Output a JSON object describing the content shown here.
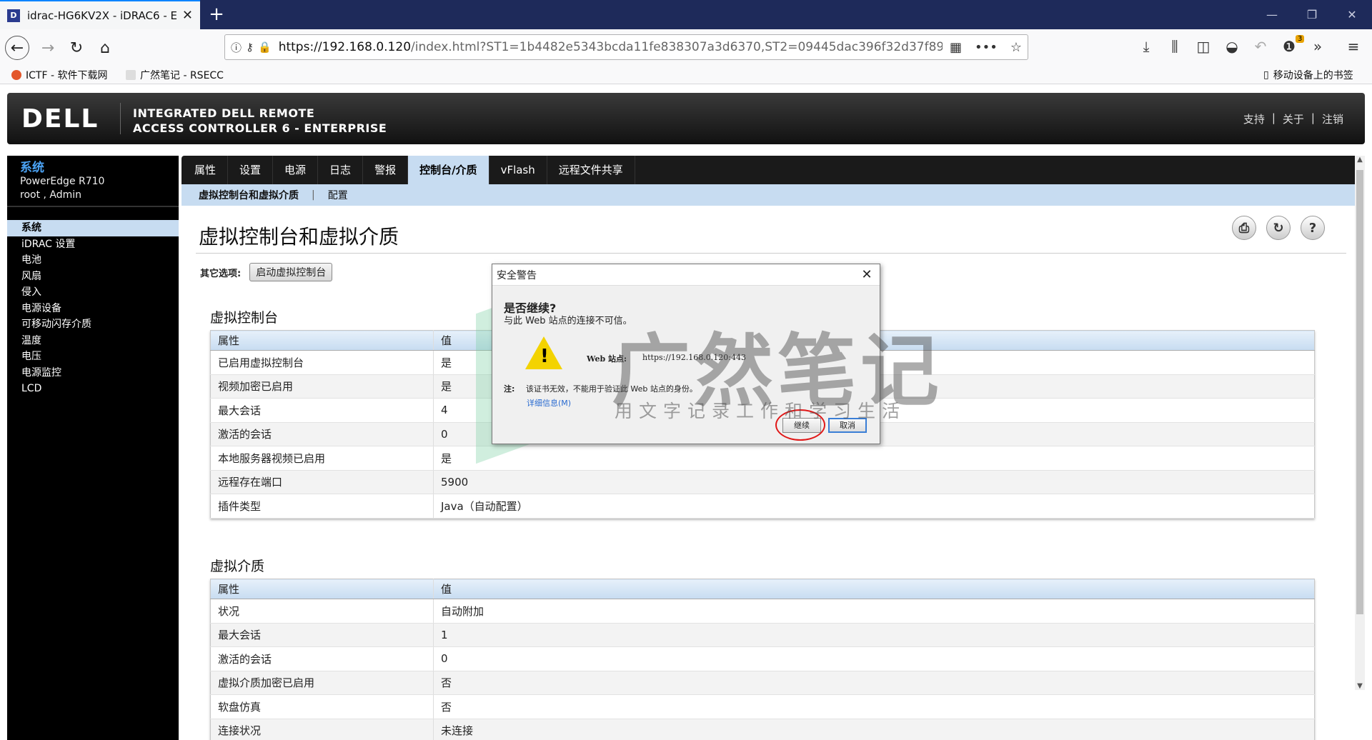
{
  "browser": {
    "tab_title": "idrac-HG6KV2X - iDRAC6 - E",
    "favicon_letter": "D",
    "url_host": "https://192.168.0.120",
    "url_rest": "/index.html?ST1=1b4482e5343bcda11fe838307a3d6370,ST2=09445dac396f32d37f89a",
    "badge_count": "3",
    "bookmarks": [
      "ICTF - 软件下载网",
      "广然笔记 - RSECC"
    ],
    "mobile_bookmarks": "移动设备上的书签"
  },
  "header": {
    "logo": "DELL",
    "title_line1": "INTEGRATED DELL REMOTE",
    "title_line2": "ACCESS CONTROLLER 6 - ENTERPRISE",
    "links": [
      "支持",
      "关于",
      "注销"
    ],
    "sep": "|"
  },
  "sidebar": {
    "sys_title": "系统",
    "model": "PowerEdge R710",
    "user": "root , Admin",
    "items": [
      "系统",
      "iDRAC 设置",
      "电池",
      "风扇",
      "侵入",
      "电源设备",
      "可移动闪存介质",
      "温度",
      "电压",
      "电源监控",
      "LCD"
    ]
  },
  "tabs": {
    "main": [
      "属性",
      "设置",
      "电源",
      "日志",
      "警报",
      "控制台/介质",
      "vFlash",
      "远程文件共享"
    ],
    "sub": [
      "虚拟控制台和虚拟介质",
      "配置"
    ]
  },
  "main": {
    "title": "虚拟控制台和虚拟介质",
    "options_label": "其它选项:",
    "launch_button": "启动虚拟控制台",
    "vc_section": "虚拟控制台",
    "vm_section": "虚拟介质",
    "col_prop": "属性",
    "col_val": "值",
    "vc_rows": [
      [
        "已启用虚拟控制台",
        "是"
      ],
      [
        "视频加密已启用",
        "是"
      ],
      [
        "最大会话",
        "4"
      ],
      [
        "激活的会话",
        "0"
      ],
      [
        "本地服务器视频已启用",
        "是"
      ],
      [
        "远程存在端口",
        "5900"
      ],
      [
        "插件类型",
        "Java（自动配置）"
      ]
    ],
    "vm_rows": [
      [
        "状况",
        "自动附加"
      ],
      [
        "最大会话",
        "1"
      ],
      [
        "激活的会话",
        "0"
      ],
      [
        "虚拟介质加密已启用",
        "否"
      ],
      [
        "软盘仿真",
        "否"
      ],
      [
        "连接状况",
        "未连接"
      ]
    ]
  },
  "dialog": {
    "title": "安全警告",
    "question": "是否继续?",
    "message": "与此 Web 站点的连接不可信。",
    "site_label": "Web 站点:",
    "site_value": "https://192.168.0.120:443",
    "note_label": "注:",
    "note_text": "该证书无效，不能用于验证此 Web 站点的身份。",
    "details_link": "详细信息(M)",
    "continue_button": "继续",
    "cancel_button": "取消"
  },
  "watermark": {
    "text": "广然笔记",
    "sub": "用文字记录工作和学习生活"
  }
}
